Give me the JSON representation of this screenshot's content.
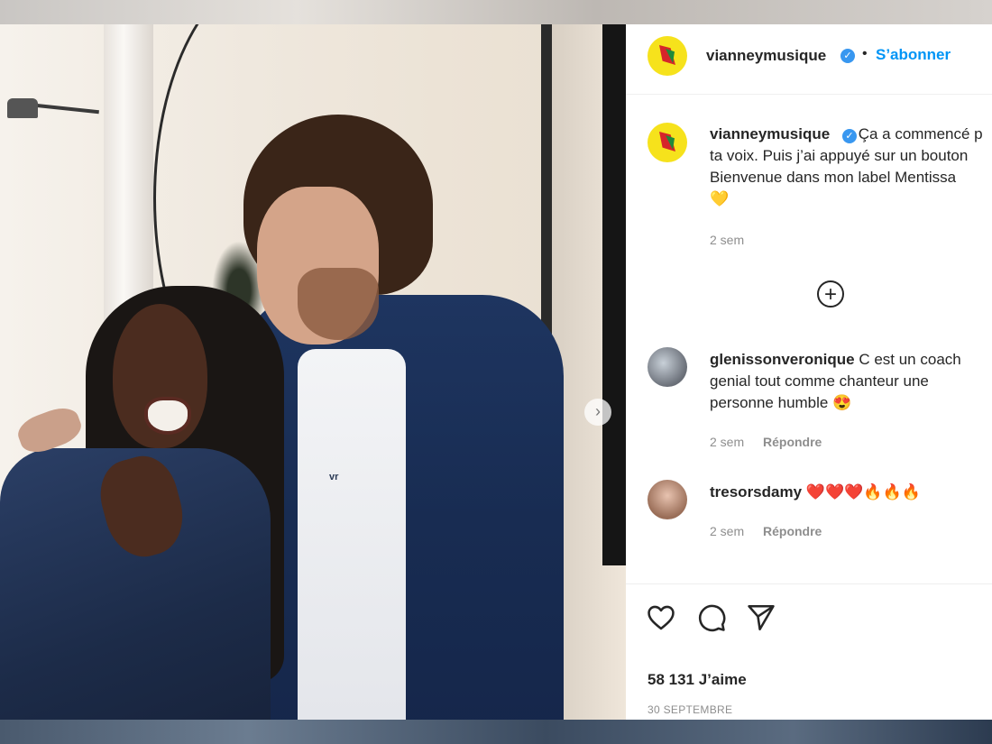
{
  "post": {
    "username": "vianneymusique",
    "follow_label": "S’abonner",
    "separator": "•",
    "caption_line1": "Ça a commencé p",
    "caption_line2": "ta voix. Puis j’ai appuyé sur un bouton",
    "caption_line3": "Bienvenue dans mon label Mentissa",
    "caption_emoji": "💛",
    "caption_time": "2 sem",
    "load_more": "+"
  },
  "comments": [
    {
      "username": "glenissonveronique",
      "text_line1": "C est un coach",
      "text_line2": "genial tout comme chanteur une",
      "text_line3": "personne humble 😍",
      "time": "2 sem",
      "reply": "Répondre"
    },
    {
      "username": "tresorsdamy",
      "text_line1": "❤️❤️❤️🔥🔥🔥",
      "time": "2 sem",
      "reply": "Répondre"
    }
  ],
  "actions": {
    "like_icon": "heart-icon",
    "comment_icon": "comment-icon",
    "share_icon": "share-icon"
  },
  "stats": {
    "likes": "58 131 J’aime",
    "date": "30 SEPTEMBRE"
  },
  "carousel": {
    "arrow": "›"
  },
  "colors": {
    "accent": "#0095f6",
    "verified": "#3897f0",
    "brand_yellow": "#f6e21c"
  }
}
